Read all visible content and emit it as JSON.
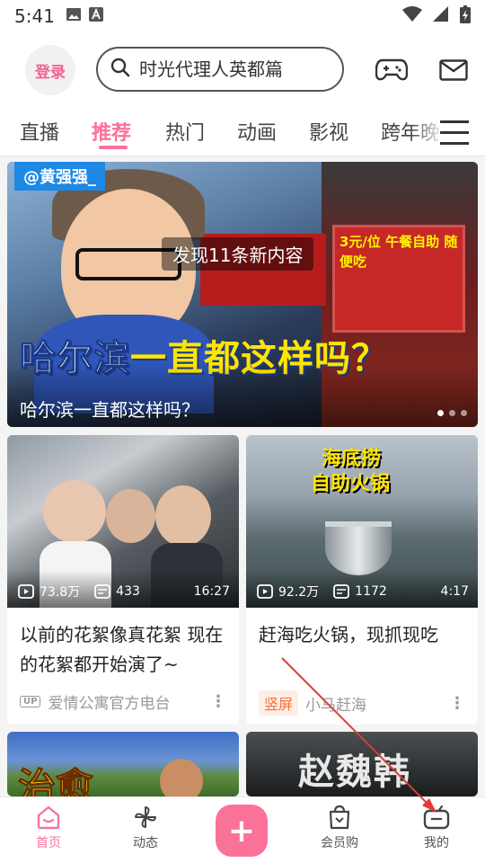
{
  "status_bar": {
    "time": "5:41"
  },
  "header": {
    "login_label": "登录",
    "search_placeholder": "时光代理人英都篇"
  },
  "tabs": [
    {
      "label": "直播"
    },
    {
      "label": "推荐"
    },
    {
      "label": "热门"
    },
    {
      "label": "动画"
    },
    {
      "label": "影视"
    },
    {
      "label": "跨年晚"
    }
  ],
  "active_tab": "推荐",
  "banner": {
    "uploader_tag": "@黄强强_",
    "toast": "发现11条新内容",
    "overlay_title_white": "哈尔滨",
    "overlay_title_yellow": "一直都这样吗？",
    "caption": "哈尔滨一直都这样吗？",
    "sign_text": "3元/位 午餐自助 随便吃"
  },
  "cards": [
    {
      "views": "73.8万",
      "comments": "433",
      "duration": "16:27",
      "title": "以前的花絮像真花絮 现在的花絮都开始演了~",
      "badge": "UP",
      "author": "爱情公寓官方电台"
    },
    {
      "views": "92.2万",
      "comments": "1172",
      "duration": "4:17",
      "title": "赶海吃火锅，现抓现吃",
      "badge": "竖屏",
      "author": "小马赶海",
      "overlay_line1": "海底捞",
      "overlay_line2": "自助火锅"
    },
    {
      "overlay": "治愈"
    },
    {
      "overlay": "赵魏韩"
    }
  ],
  "bottom_nav": {
    "home": "首页",
    "dynamic": "动态",
    "vip": "会员购",
    "mine": "我的"
  },
  "colors": {
    "accent": "#fb7299",
    "annotation_arrow": "#e53935"
  }
}
